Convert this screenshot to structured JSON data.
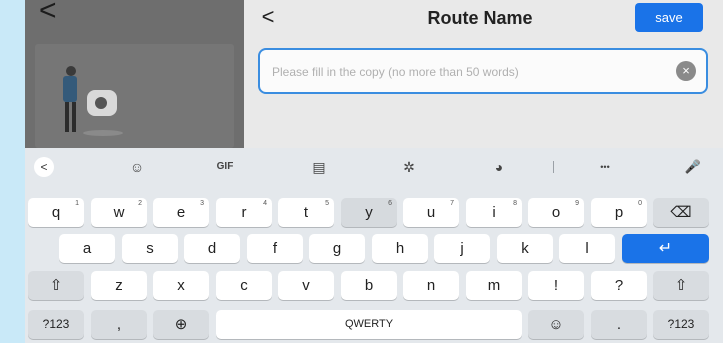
{
  "background_app": {
    "back_glyph": "<"
  },
  "modal": {
    "back_glyph": "<",
    "title": "Route Name",
    "save_label": "save",
    "copy_input": {
      "value": "",
      "placeholder": "Please fill in the copy (no more than 50 words)"
    },
    "clear_glyph": "×"
  },
  "keyboard": {
    "toolbar": {
      "back_glyph": "<",
      "sticker_glyph": "☺",
      "gif_label": "GIF",
      "clipboard_glyph": "▤",
      "settings_glyph": "✲",
      "theme_glyph": "◕",
      "more_glyph": "•••",
      "mic_glyph": "🎤"
    },
    "row1": [
      {
        "label": "q",
        "hint": "1"
      },
      {
        "label": "w",
        "hint": "2"
      },
      {
        "label": "e",
        "hint": "3"
      },
      {
        "label": "r",
        "hint": "4"
      },
      {
        "label": "t",
        "hint": "5"
      },
      {
        "label": "y",
        "hint": "6"
      },
      {
        "label": "u",
        "hint": "7"
      },
      {
        "label": "i",
        "hint": "8"
      },
      {
        "label": "o",
        "hint": "9"
      },
      {
        "label": "p",
        "hint": "0"
      }
    ],
    "backspace_glyph": "⌫",
    "row2": [
      "a",
      "s",
      "d",
      "f",
      "g",
      "h",
      "j",
      "k",
      "l"
    ],
    "enter_glyph": "↵",
    "row3": [
      "z",
      "x",
      "c",
      "v",
      "b",
      "n",
      "m",
      "!",
      "?"
    ],
    "shift_glyph": "⇧",
    "row4": {
      "symbols_label": "?123",
      "comma_label": ",",
      "globe_glyph": "⊕",
      "space_label": "QWERTY",
      "emoji_glyph": "☺",
      "period_label": ".",
      "symbols_right_label": "?123"
    },
    "colors": {
      "accent": "#1a73e8",
      "key": "#ffffff",
      "fn_key": "#d8dce0",
      "background": "#e4e8ec"
    }
  }
}
